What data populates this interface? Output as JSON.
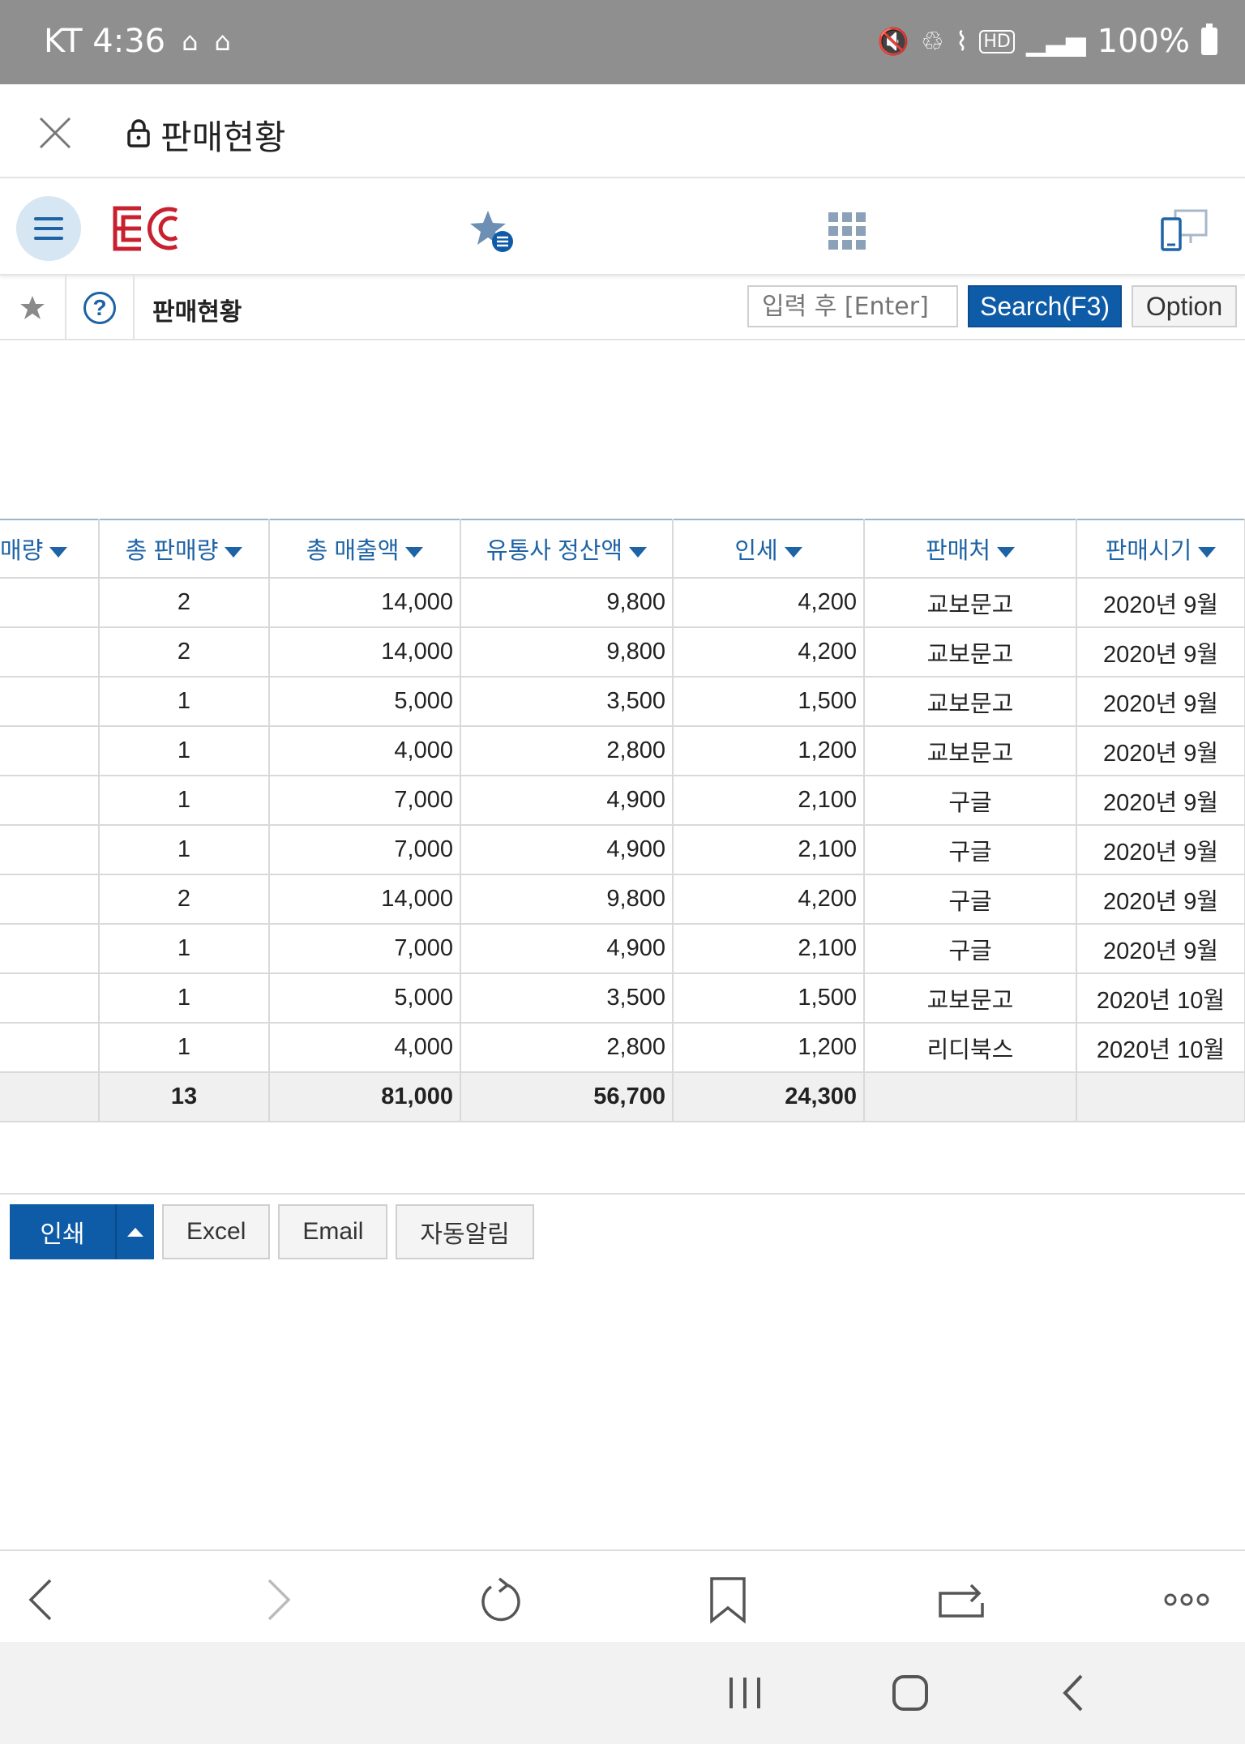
{
  "status_bar": {
    "carrier_time": "KT 4:36",
    "battery": "100%",
    "network": "HD"
  },
  "title_bar": {
    "title": "판매현황"
  },
  "app_bar": {
    "logo": "EC",
    "icons": [
      "menu-icon",
      "favorites-icon",
      "apps-grid-icon",
      "device-switch-icon"
    ]
  },
  "search_bar": {
    "title": "판매현황",
    "input_placeholder": "입력 후 [Enter]",
    "search_label": "Search(F3)",
    "option_label": "Option"
  },
  "table": {
    "headers": [
      "매량",
      "총 판매량",
      "총 매출액",
      "유통사 정산액",
      "인세",
      "판매처",
      "판매시기"
    ],
    "rows": [
      [
        "",
        "2",
        "14,000",
        "9,800",
        "4,200",
        "교보문고",
        "2020년 9월"
      ],
      [
        "",
        "2",
        "14,000",
        "9,800",
        "4,200",
        "교보문고",
        "2020년 9월"
      ],
      [
        "",
        "1",
        "5,000",
        "3,500",
        "1,500",
        "교보문고",
        "2020년 9월"
      ],
      [
        "",
        "1",
        "4,000",
        "2,800",
        "1,200",
        "교보문고",
        "2020년 9월"
      ],
      [
        "",
        "1",
        "7,000",
        "4,900",
        "2,100",
        "구글",
        "2020년 9월"
      ],
      [
        "",
        "1",
        "7,000",
        "4,900",
        "2,100",
        "구글",
        "2020년 9월"
      ],
      [
        "",
        "2",
        "14,000",
        "9,800",
        "4,200",
        "구글",
        "2020년 9월"
      ],
      [
        "",
        "1",
        "7,000",
        "4,900",
        "2,100",
        "구글",
        "2020년 9월"
      ],
      [
        "",
        "1",
        "5,000",
        "3,500",
        "1,500",
        "교보문고",
        "2020년 10월"
      ],
      [
        "",
        "1",
        "4,000",
        "2,800",
        "1,200",
        "리디북스",
        "2020년 10월"
      ]
    ],
    "totals": [
      "",
      "13",
      "81,000",
      "56,700",
      "24,300",
      "",
      ""
    ]
  },
  "actions": {
    "print_label": "인쇄",
    "excel_label": "Excel",
    "email_label": "Email",
    "auto_alert_label": "자동알림"
  },
  "colors": {
    "accent": "#0e5ba7",
    "header_text": "#1e63a5",
    "logo_red": "#c8202f",
    "status_bar": "#8f8f8f"
  }
}
